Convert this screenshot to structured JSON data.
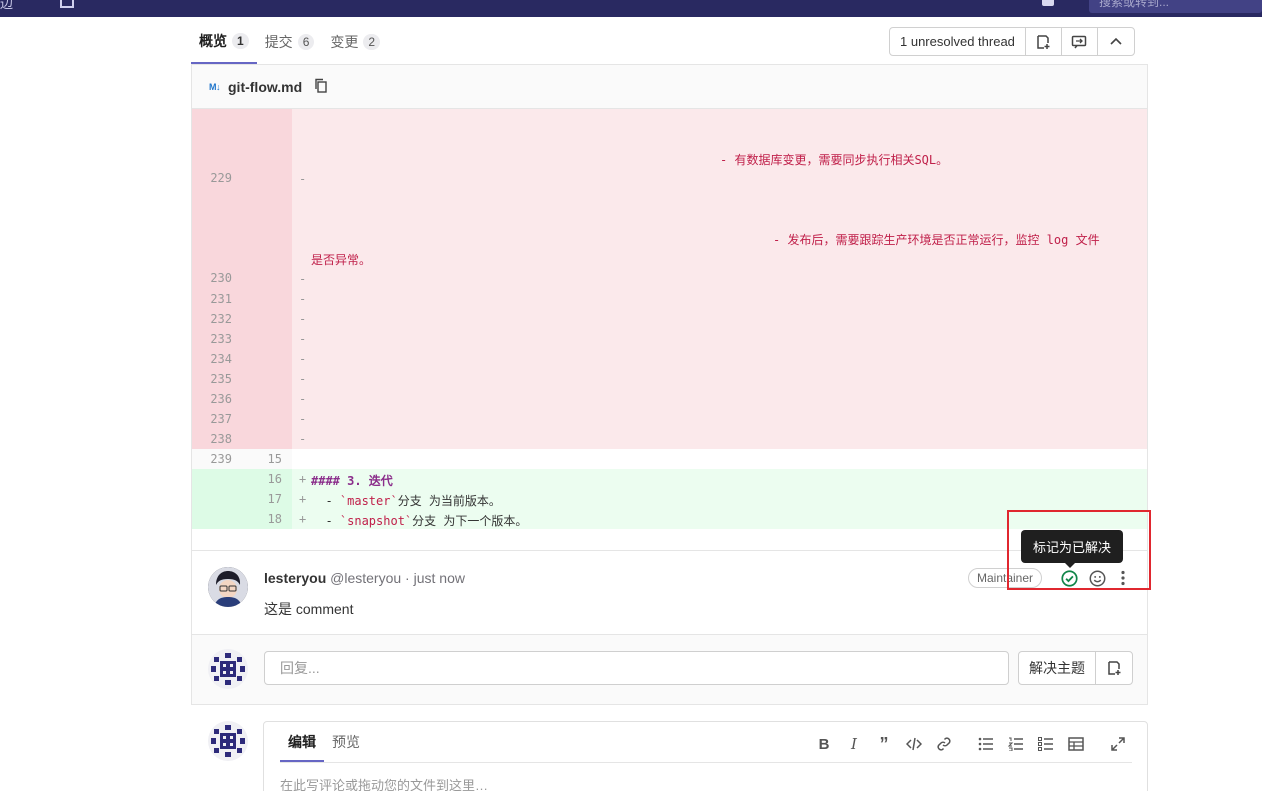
{
  "topbar": {
    "left_text": "边",
    "search_placeholder": "搜索或转到..."
  },
  "tabs": [
    {
      "label": "概览",
      "count": "1"
    },
    {
      "label": "提交",
      "count": "6"
    },
    {
      "label": "变更",
      "count": "2"
    }
  ],
  "thread_controls": {
    "label": "1 unresolved thread"
  },
  "file": {
    "badge": "M↓",
    "name": "git-flow.md"
  },
  "diff": {
    "deleted_text_1": "- 有数据库变更，需要同步执行相关SQL。",
    "deleted_text_2a": "- 发布后，需要跟踪生产环境是否正常运行，监控 log 文件",
    "deleted_text_2b": "是否异常。",
    "lines": {
      "l229": "229",
      "l230": "230",
      "l231": "231",
      "l232": "232",
      "l233": "233",
      "l234": "234",
      "l235": "235",
      "l236": "236",
      "l237": "237",
      "l238": "238",
      "l239": "239",
      "n15": "15",
      "n16": "16",
      "n17": "17",
      "n18": "18"
    },
    "minus": "-",
    "plus": "+",
    "add1_hash": "#### 3. 迭代",
    "add2_pre": "  - ",
    "add2_code": "`master`",
    "add2_post": "分支 为当前版本。",
    "add3_pre": "  - ",
    "add3_code": "`snapshot`",
    "add3_post": "分支 为下一个版本。"
  },
  "comment": {
    "author_name": "lesteryou",
    "author_meta": "@lesteryou · just now",
    "body": "这是 comment",
    "role": "Maintainer",
    "tooltip": "标记为已解决"
  },
  "reply": {
    "placeholder": "回复...",
    "resolve_label": "解决主题"
  },
  "editor": {
    "tab_edit": "编辑",
    "tab_preview": "预览",
    "placeholder": "在此写评论或拖动您的文件到这里…"
  },
  "colors": {
    "accent": "#6666c4",
    "deleted_bg": "#fbe9eb",
    "added_bg": "#ecfdf0",
    "resolve_green": "#108548",
    "highlight_red": "#e0272f"
  }
}
